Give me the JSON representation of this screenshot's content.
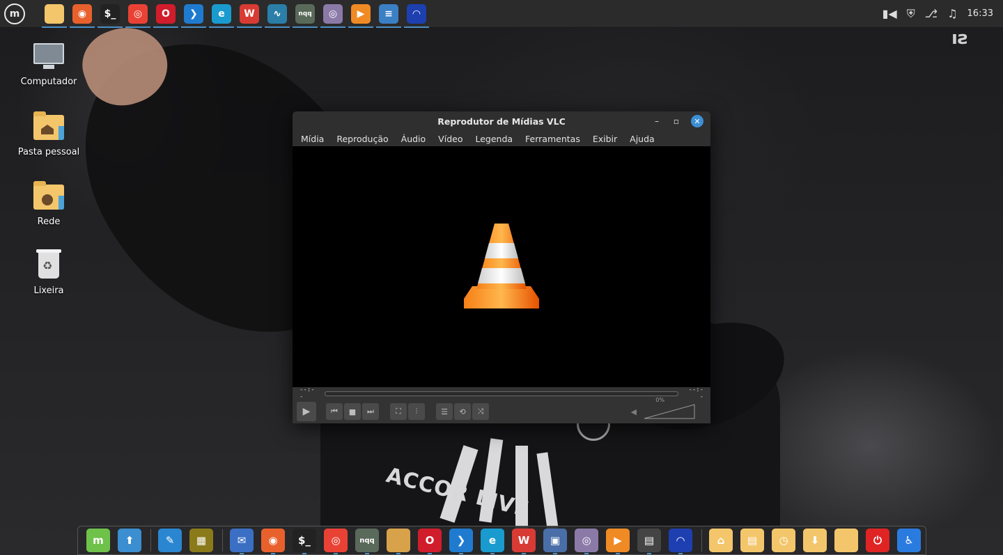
{
  "panel": {
    "clock": "16:33",
    "launchers": [
      {
        "icon": "folder-icon",
        "color": "#f3c66b"
      },
      {
        "icon": "firefox-icon",
        "color": "#e8612c"
      },
      {
        "icon": "terminal-icon",
        "color": "#222222"
      },
      {
        "icon": "chrome-icon",
        "color": "#e94235"
      },
      {
        "icon": "opera-icon",
        "color": "#d11d2b"
      },
      {
        "icon": "vscode-icon",
        "color": "#1f7bd0"
      },
      {
        "icon": "edge-beta-icon",
        "color": "#1a9bcf"
      },
      {
        "icon": "wps-office-icon",
        "color": "#d83b34"
      },
      {
        "icon": "system-monitor-icon",
        "color": "#2a7ea8"
      },
      {
        "icon": "nqq-icon",
        "color": "#5a6a5a"
      },
      {
        "icon": "camera-app-icon",
        "color": "#8b7aa8"
      },
      {
        "icon": "media-player-icon",
        "color": "#f08a24"
      },
      {
        "icon": "app-grid-icon",
        "color": "#3b7fc4"
      },
      {
        "icon": "audacity-icon",
        "color": "#1d3fb0"
      }
    ]
  },
  "desktop": {
    "icons": [
      {
        "label": "Computador"
      },
      {
        "label": "Pasta pessoal"
      },
      {
        "label": "Rede"
      },
      {
        "label": "Lixeira"
      }
    ]
  },
  "wallpaper": {
    "sponsor_text": "ACCOR LIVE"
  },
  "vlc": {
    "title": "Reprodutor de Mídias VLC",
    "menu": [
      "Mídia",
      "Reprodução",
      "Áudio",
      "Vídeo",
      "Legenda",
      "Ferramentas",
      "Exibir",
      "Ajuda"
    ],
    "time_elapsed": "--:--",
    "time_total": "--:--",
    "volume": "0%"
  },
  "dock": {
    "items": [
      {
        "icon": "mint-menu-icon",
        "color": "#6ec24a"
      },
      {
        "icon": "update-manager-icon",
        "color": "#3b8ed0"
      },
      {
        "icon": "text-editor-icon",
        "color": "#2a86d1"
      },
      {
        "icon": "image-viewer-icon",
        "color": "#8a7a1a"
      },
      {
        "icon": "mail-icon",
        "color": "#3a6fc4"
      },
      {
        "icon": "firefox-icon",
        "color": "#e8612c"
      },
      {
        "icon": "terminal-icon",
        "color": "#222222"
      },
      {
        "icon": "chrome-icon",
        "color": "#e94235"
      },
      {
        "icon": "nqq-icon",
        "color": "#5a6a5a"
      },
      {
        "icon": "files-icon",
        "color": "#d8a24a"
      },
      {
        "icon": "opera-icon",
        "color": "#d11d2b"
      },
      {
        "icon": "vscode-icon",
        "color": "#1f7bd0"
      },
      {
        "icon": "edge-beta-icon",
        "color": "#1a9bcf"
      },
      {
        "icon": "wps-office-icon",
        "color": "#d83b34"
      },
      {
        "icon": "virtualbox-icon",
        "color": "#4a6fa8"
      },
      {
        "icon": "camera-app-icon",
        "color": "#8b7aa8"
      },
      {
        "icon": "media-player-icon",
        "color": "#f08a24"
      },
      {
        "icon": "video-editor-icon",
        "color": "#444444"
      },
      {
        "icon": "audacity-icon",
        "color": "#1d3fb0"
      },
      {
        "icon": "home-folder-icon",
        "color": "#f3c66b"
      },
      {
        "icon": "documents-folder-icon",
        "color": "#f3c66b"
      },
      {
        "icon": "recent-folder-icon",
        "color": "#f3c66b"
      },
      {
        "icon": "downloads-folder-icon",
        "color": "#f3c66b"
      },
      {
        "icon": "folder-icon",
        "color": "#f3c66b"
      },
      {
        "icon": "power-icon",
        "color": "#e02424"
      },
      {
        "icon": "accessibility-icon",
        "color": "#2a7be0"
      }
    ]
  }
}
